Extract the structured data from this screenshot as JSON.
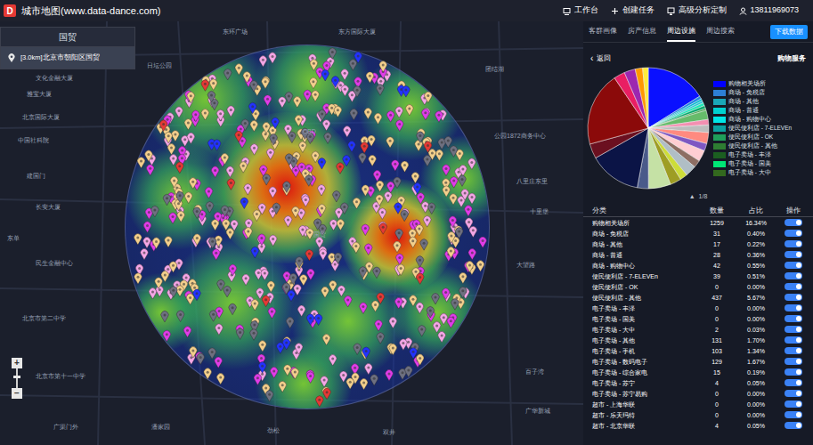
{
  "app": {
    "logo": "D",
    "title": "城市地图(www.data-dance.com)"
  },
  "header_menu": [
    {
      "label": "工作台"
    },
    {
      "label": "创建任务"
    },
    {
      "label": "高级分析定制"
    },
    {
      "label": "13811969073"
    }
  ],
  "search_panel": {
    "title": "国贸",
    "results": [
      {
        "text": "[3.0km]北京市朝阳区国贸",
        "selected": true
      }
    ]
  },
  "zoom": {
    "in": "+",
    "out": "−"
  },
  "map": {
    "labels": [
      "文化金融大厦",
      "雅宝大厦",
      "北京国际大厦",
      "日坛公园",
      "中国社科院",
      "建国门",
      "长安大厦",
      "民生金融中心",
      "北京市第二中学",
      "北京市第十一中学",
      "东方国际大厦",
      "东环广场",
      "团结湖",
      "公园1872商务中心",
      "八里庄东里",
      "十里堡",
      "大望路",
      "百子湾",
      "广华新城",
      "双井",
      "劲松",
      "潘家园",
      "广渠门外",
      "东单",
      "CBD",
      "国贸"
    ],
    "pin_groups": [
      {
        "color": "#f4a6e6",
        "count": 130
      },
      {
        "color": "#e03ce8",
        "count": 95
      },
      {
        "color": "#f3cf8c",
        "count": 150
      },
      {
        "color": "#6e7080",
        "count": 80
      },
      {
        "color": "#2233ff",
        "count": 25
      },
      {
        "color": "#e53935",
        "count": 15
      }
    ]
  },
  "tabs": [
    {
      "label": "客群画像",
      "selected": false
    },
    {
      "label": "房产信息",
      "selected": false
    },
    {
      "label": "周边设施",
      "selected": true
    },
    {
      "label": "周边搜索",
      "selected": false
    }
  ],
  "download_button": "下载数据",
  "back": {
    "icon": "‹",
    "label": "返回"
  },
  "panel_title": "购物服务",
  "pie": {
    "slices": [
      {
        "value": 16.3,
        "color": "#0a10ff"
      },
      {
        "value": 0.8,
        "color": "#1e88e5"
      },
      {
        "value": 0.6,
        "color": "#00bcd4"
      },
      {
        "value": 0.6,
        "color": "#26c6da"
      },
      {
        "value": 0.8,
        "color": "#1de9b6"
      },
      {
        "value": 0.8,
        "color": "#00a86b"
      },
      {
        "value": 0.5,
        "color": "#43a047"
      },
      {
        "value": 2.5,
        "color": "#66bb6a"
      },
      {
        "value": 1.5,
        "color": "#f48fb1"
      },
      {
        "value": 2,
        "color": "#bdbdbd"
      },
      {
        "value": 3,
        "color": "#ff8a80"
      },
      {
        "value": 2,
        "color": "#7e57c2"
      },
      {
        "value": 3,
        "color": "#ffcdd2"
      },
      {
        "value": 2,
        "color": "#8d6e63"
      },
      {
        "value": 3,
        "color": "#b0bec5"
      },
      {
        "value": 2,
        "color": "#cddc39"
      },
      {
        "value": 3,
        "color": "#9e9d24"
      },
      {
        "value": 6,
        "color": "#c5e1a5"
      },
      {
        "value": 3,
        "color": "#4a5a8a"
      },
      {
        "value": 14,
        "color": "#0b1446"
      },
      {
        "value": 4,
        "color": "#6b1020"
      },
      {
        "value": 20,
        "color": "#8b0a0a"
      },
      {
        "value": 3,
        "color": "#e91e63"
      },
      {
        "value": 3,
        "color": "#9c27b0"
      },
      {
        "value": 2,
        "color": "#ff9800"
      },
      {
        "value": 1.5,
        "color": "#ffeb3b"
      }
    ]
  },
  "legend": [
    {
      "label": "购物相关场所",
      "color": "#0000ff"
    },
    {
      "label": "商场 - 免税店",
      "color": "#2d7fd6"
    },
    {
      "label": "商场 - 其他",
      "color": "#1aa6b7"
    },
    {
      "label": "商场 - 普通",
      "color": "#00d0d0"
    },
    {
      "label": "商场 - 购物中心",
      "color": "#00e6e6"
    },
    {
      "label": "便民便利店 - 7-ELEVEn",
      "color": "#0aa0a0"
    },
    {
      "label": "便民便利店 - OK",
      "color": "#1f9e5a"
    },
    {
      "label": "便民便利店 - 其他",
      "color": "#2e7d32"
    },
    {
      "label": "电子卖场 - 丰泽",
      "color": "#1b5e20"
    },
    {
      "label": "电子卖场 - 国美",
      "color": "#00e676"
    },
    {
      "label": "电子卖场 - 大中",
      "color": "#33691e"
    }
  ],
  "pager": {
    "prev": "▲",
    "current": "1/8"
  },
  "table": {
    "columns": [
      "分类",
      "数量",
      "占比",
      "操作"
    ],
    "rows": [
      {
        "cells": [
          "购物相关场所",
          "1259",
          "16.34%"
        ],
        "on": true
      },
      {
        "cells": [
          "商场 - 免税店",
          "31",
          "0.40%"
        ],
        "on": true
      },
      {
        "cells": [
          "商场 - 其他",
          "17",
          "0.22%"
        ],
        "on": true
      },
      {
        "cells": [
          "商场 - 普通",
          "28",
          "0.36%"
        ],
        "on": true
      },
      {
        "cells": [
          "商场 - 购物中心",
          "42",
          "0.55%"
        ],
        "on": true
      },
      {
        "cells": [
          "便民便利店 - 7-ELEVEn",
          "39",
          "0.51%"
        ],
        "on": true
      },
      {
        "cells": [
          "便民便利店 - OK",
          "0",
          "0.00%"
        ],
        "on": true
      },
      {
        "cells": [
          "便民便利店 - 其他",
          "437",
          "5.67%"
        ],
        "on": true
      },
      {
        "cells": [
          "电子卖场 - 丰泽",
          "0",
          "0.00%"
        ],
        "on": true
      },
      {
        "cells": [
          "电子卖场 - 国美",
          "0",
          "0.00%"
        ],
        "on": true
      },
      {
        "cells": [
          "电子卖场 - 大中",
          "2",
          "0.03%"
        ],
        "on": true
      },
      {
        "cells": [
          "电子卖场 - 其他",
          "131",
          "1.70%"
        ],
        "on": true
      },
      {
        "cells": [
          "电子卖场 - 手机",
          "103",
          "1.34%"
        ],
        "on": true
      },
      {
        "cells": [
          "电子卖场 - 数码电子",
          "129",
          "1.67%"
        ],
        "on": true
      },
      {
        "cells": [
          "电子卖场 - 综合家电",
          "15",
          "0.19%"
        ],
        "on": true
      },
      {
        "cells": [
          "电子卖场 - 苏宁",
          "4",
          "0.05%"
        ],
        "on": true
      },
      {
        "cells": [
          "电子卖场 - 苏宁易购",
          "0",
          "0.00%"
        ],
        "on": true
      },
      {
        "cells": [
          "超市 - 上海华联",
          "0",
          "0.00%"
        ],
        "on": true
      },
      {
        "cells": [
          "超市 - 乐天玛特",
          "0",
          "0.00%"
        ],
        "on": true
      },
      {
        "cells": [
          "超市 - 北京华联",
          "4",
          "0.05%"
        ],
        "on": true
      }
    ]
  }
}
